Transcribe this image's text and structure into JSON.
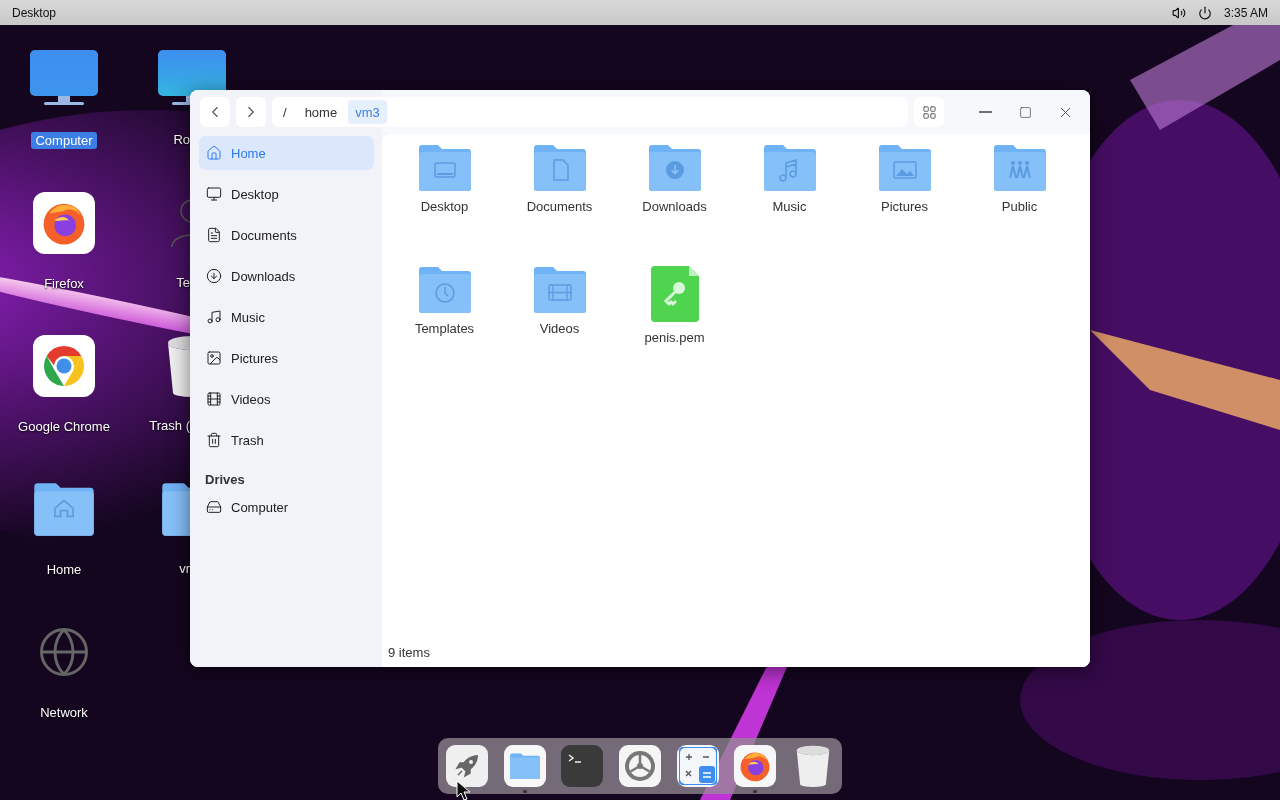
{
  "top_bar": {
    "title": "Desktop",
    "clock": "3:35 AM"
  },
  "desktop_icons": [
    {
      "label": "Computer",
      "kind": "computer",
      "selected": true
    },
    {
      "label": "Firefox",
      "kind": "firefox",
      "selected": false
    },
    {
      "label": "Google Chrome",
      "kind": "chrome",
      "selected": false
    },
    {
      "label": "Home",
      "kind": "home",
      "selected": false
    },
    {
      "label": "Network",
      "kind": "network",
      "selected": false
    }
  ],
  "desktop_icons_partial": [
    {
      "label": "Ro",
      "kind": "computer"
    },
    {
      "label": "Te",
      "kind": "person"
    },
    {
      "label": "Trash (",
      "kind": "trash"
    },
    {
      "label": "vr",
      "kind": "folder"
    }
  ],
  "window": {
    "breadcrumb": [
      {
        "label": "/",
        "selected": false
      },
      {
        "label": "home",
        "selected": false
      },
      {
        "label": "vm3",
        "selected": true
      }
    ],
    "sidebar": {
      "places": [
        {
          "label": "Home",
          "kind": "home",
          "selected": true
        },
        {
          "label": "Desktop",
          "kind": "desktop",
          "selected": false
        },
        {
          "label": "Documents",
          "kind": "documents",
          "selected": false
        },
        {
          "label": "Downloads",
          "kind": "downloads",
          "selected": false
        },
        {
          "label": "Music",
          "kind": "music",
          "selected": false
        },
        {
          "label": "Pictures",
          "kind": "pictures",
          "selected": false
        },
        {
          "label": "Videos",
          "kind": "videos",
          "selected": false
        },
        {
          "label": "Trash",
          "kind": "trash",
          "selected": false
        }
      ],
      "drives_heading": "Drives",
      "drives": [
        {
          "label": "Computer",
          "kind": "drive",
          "selected": false
        }
      ]
    },
    "files": [
      {
        "name": "Desktop",
        "kind": "desktop"
      },
      {
        "name": "Documents",
        "kind": "documents"
      },
      {
        "name": "Downloads",
        "kind": "downloads"
      },
      {
        "name": "Music",
        "kind": "music"
      },
      {
        "name": "Pictures",
        "kind": "pictures"
      },
      {
        "name": "Public",
        "kind": "public"
      },
      {
        "name": "Templates",
        "kind": "templates"
      },
      {
        "name": "Videos",
        "kind": "videos"
      },
      {
        "name": "penis.pem",
        "kind": "key-file"
      }
    ],
    "status": "9 items"
  },
  "dock": [
    {
      "kind": "launcher",
      "running": false
    },
    {
      "kind": "files",
      "running": true
    },
    {
      "kind": "terminal",
      "running": false
    },
    {
      "kind": "settings",
      "running": false
    },
    {
      "kind": "calculator",
      "running": false
    },
    {
      "kind": "firefox",
      "running": true
    },
    {
      "kind": "trash",
      "running": false
    }
  ]
}
